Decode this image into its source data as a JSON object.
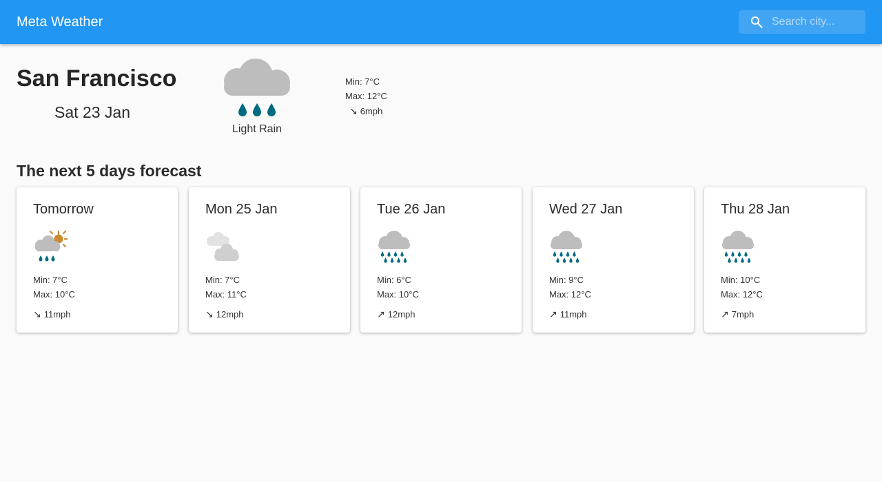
{
  "appbar": {
    "title": "Meta Weather",
    "search_placeholder": "Search city..."
  },
  "current": {
    "city": "San Francisco",
    "date": "Sat 23 Jan",
    "condition": "Light Rain",
    "icon": "light-rain-icon",
    "min": "Min: 7°C",
    "max": "Max: 12°C",
    "wind_arrow": "↘",
    "wind": "6mph"
  },
  "forecast_title": "The next 5 days forecast",
  "forecast": [
    {
      "day": "Tomorrow",
      "icon": "light-rain-sun-icon",
      "min": "Min: 7°C",
      "max": "Max: 10°C",
      "wind_arrow": "↘",
      "wind": "11mph"
    },
    {
      "day": "Mon 25 Jan",
      "icon": "light-cloud-icon",
      "min": "Min: 7°C",
      "max": "Max: 11°C",
      "wind_arrow": "↘",
      "wind": "12mph"
    },
    {
      "day": "Tue 26 Jan",
      "icon": "heavy-rain-icon",
      "min": "Min: 6°C",
      "max": "Max: 10°C",
      "wind_arrow": "↗",
      "wind": "12mph"
    },
    {
      "day": "Wed 27 Jan",
      "icon": "heavy-rain-icon",
      "min": "Min: 9°C",
      "max": "Max: 12°C",
      "wind_arrow": "↗",
      "wind": "11mph"
    },
    {
      "day": "Thu 28 Jan",
      "icon": "heavy-rain-icon",
      "min": "Min: 10°C",
      "max": "Max: 12°C",
      "wind_arrow": "↗",
      "wind": "7mph"
    }
  ],
  "colors": {
    "appbar": "#2196f3",
    "cloud": "#bdbdbd",
    "light_cloud": "#d9d9d9",
    "rain": "#006b80",
    "sun": "#c98a32"
  }
}
